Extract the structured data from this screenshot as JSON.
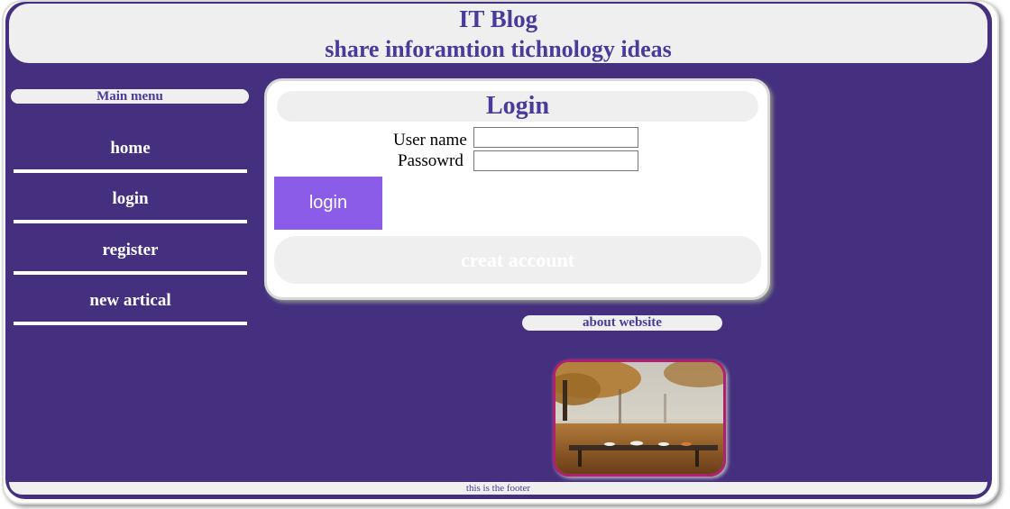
{
  "header": {
    "title": "IT Blog",
    "subtitle": "share inforamtion tichnology ideas"
  },
  "menu": {
    "title": "Main menu",
    "items": [
      {
        "label": "home"
      },
      {
        "label": "login"
      },
      {
        "label": "register"
      },
      {
        "label": "new artical"
      }
    ]
  },
  "login": {
    "title": "Login",
    "username_label": "User name",
    "password_label": "Passowrd",
    "username_value": "",
    "password_value": "",
    "login_button": "login",
    "create_account_button": "creat account"
  },
  "about": {
    "title": "about website"
  },
  "footer": {
    "text": "this is the footer"
  },
  "colors": {
    "background": "#44307f",
    "accent": "#4a3a99",
    "login_button": "#8a5ce8",
    "panel": "#efefef",
    "photo_border": "#b0206c"
  }
}
